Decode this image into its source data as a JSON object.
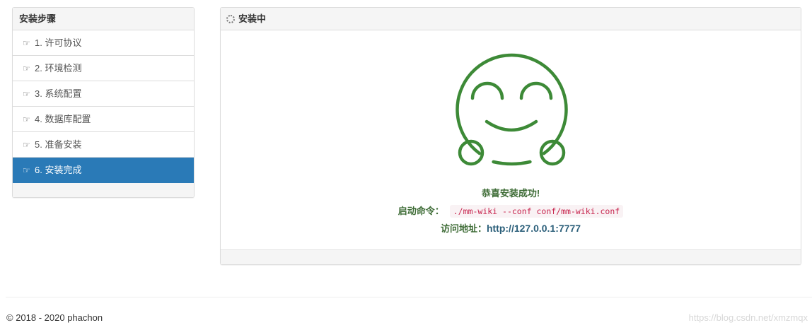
{
  "sidebar": {
    "title": "安装步骤",
    "steps": [
      {
        "label": "1. 许可协议"
      },
      {
        "label": "2. 环境检测"
      },
      {
        "label": "3. 系统配置"
      },
      {
        "label": "4. 数据库配置"
      },
      {
        "label": "5. 准备安装"
      },
      {
        "label": "6. 安装完成"
      }
    ],
    "active_step": 6,
    "hand_icon": "☞"
  },
  "main": {
    "title": "安装中",
    "success_text": "恭喜安装成功!",
    "command_label": "启动命令：",
    "command": "./mm-wiki --conf conf/mm-wiki.conf",
    "address_label": "访问地址：",
    "address": "http://127.0.0.1:7777"
  },
  "footer": {
    "copyright": "© 2018 - 2020 phachon",
    "watermark": "https://blog.csdn.net/xmzmqx"
  },
  "colors": {
    "accent": "#2a7ab7",
    "success_green": "#3d8a37",
    "message_text": "#3d6b35",
    "code_text": "#c7254e"
  },
  "icons": {
    "step": "hand-pointing-right-icon",
    "heading": "spinner-icon",
    "illustration": "smiley-face-icon"
  }
}
